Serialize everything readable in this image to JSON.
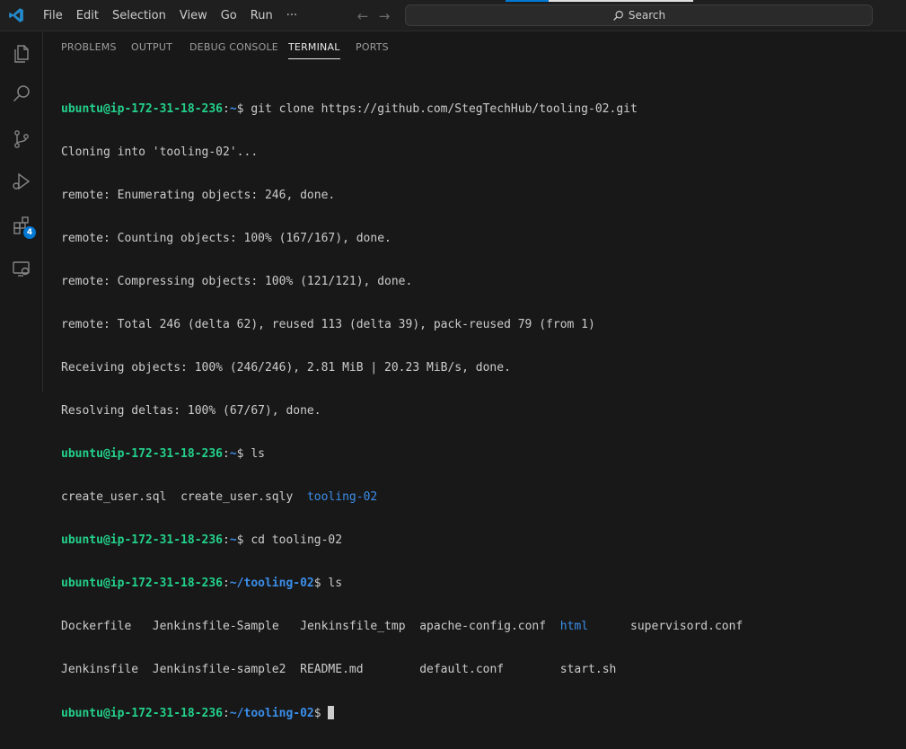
{
  "menu": [
    "File",
    "Edit",
    "Selection",
    "View",
    "Go",
    "Run",
    "···"
  ],
  "search": {
    "label": "Search"
  },
  "activity": {
    "extensions_badge": "4"
  },
  "panel": {
    "tabs": [
      "PROBLEMS",
      "OUTPUT",
      "DEBUG CONSOLE",
      "TERMINAL",
      "PORTS"
    ],
    "active_tab": "TERMINAL"
  },
  "terminal": {
    "prompt_user": "ubuntu@ip-172-31-18-236",
    "home": "~",
    "project_path": "~/tooling-02",
    "cmd_clone": "git clone https://github.com/StegTechHub/tooling-02.git",
    "out_clone": [
      "Cloning into 'tooling-02'...",
      "remote: Enumerating objects: 246, done.",
      "remote: Counting objects: 100% (167/167), done.",
      "remote: Compressing objects: 100% (121/121), done.",
      "remote: Total 246 (delta 62), reused 113 (delta 39), pack-reused 79 (from 1)",
      "Receiving objects: 100% (246/246), 2.81 MiB | 20.23 MiB/s, done.",
      "Resolving deltas: 100% (67/67), done."
    ],
    "cmd_ls": "ls",
    "ls1_files": [
      "create_user.sql",
      "create_user.sqly"
    ],
    "ls1_dir": "tooling-02",
    "cmd_cd": "cd tooling-02",
    "ls2": {
      "row1": [
        "Dockerfile",
        "Jenkinsfile-Sample",
        "Jenkinsfile_tmp",
        "apache-config.conf",
        "html",
        "supervisord.conf"
      ],
      "row2": [
        "Jenkinsfile",
        "Jenkinsfile-sample2",
        "README.md",
        "default.conf",
        "start.sh"
      ]
    }
  }
}
